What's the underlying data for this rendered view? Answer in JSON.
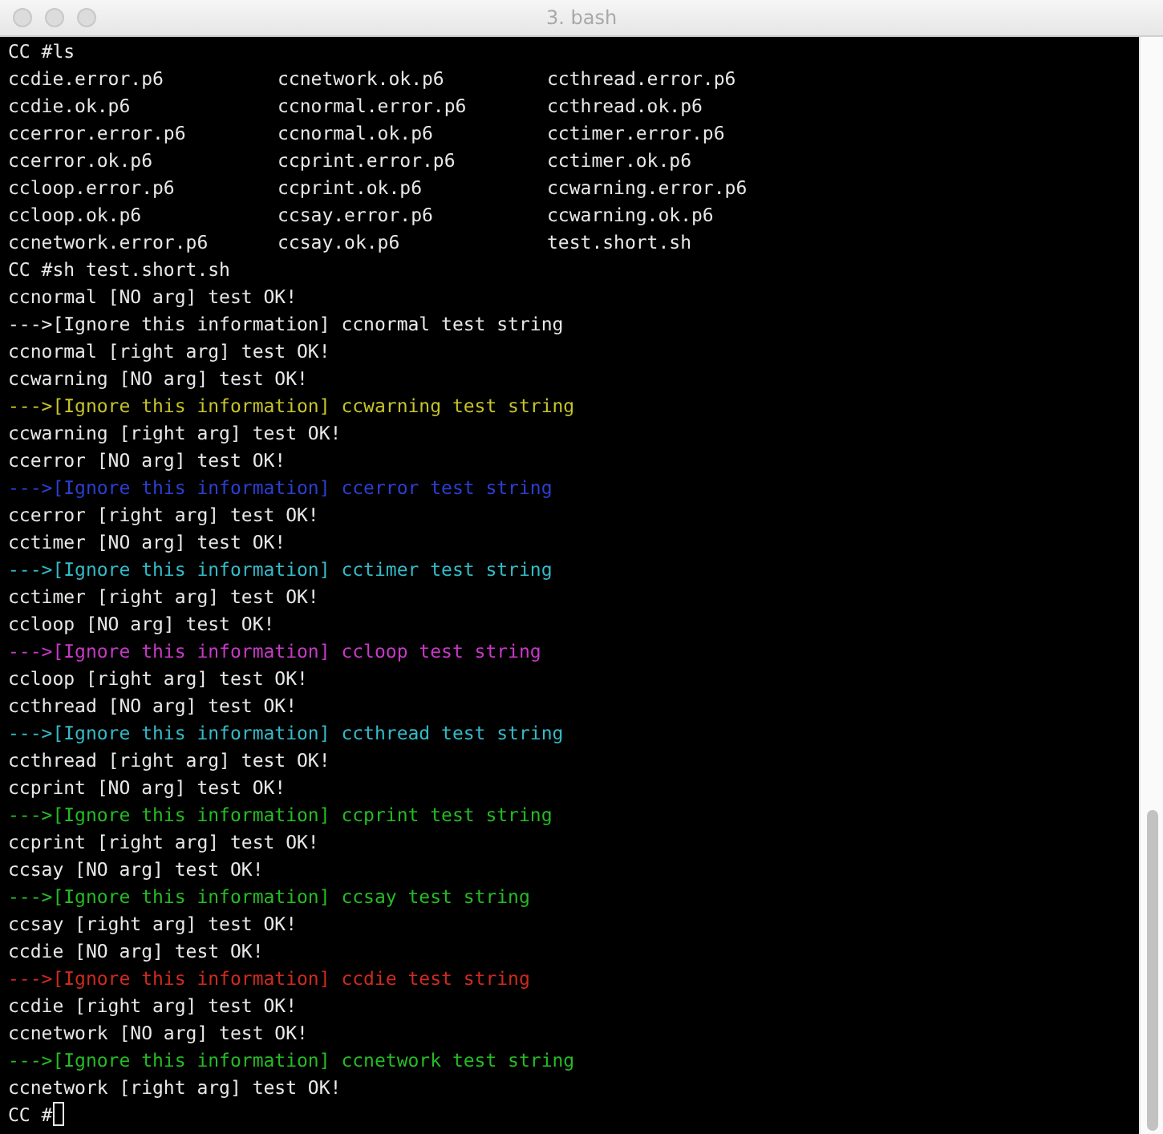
{
  "window": {
    "title": "3. bash"
  },
  "terminal": {
    "lines": [
      {
        "kind": "output",
        "text": "CC #ls"
      },
      {
        "kind": "listing",
        "columns": [
          "ccdie.error.p6",
          "ccnetwork.ok.p6",
          "ccthread.error.p6"
        ]
      },
      {
        "kind": "listing",
        "columns": [
          "ccdie.ok.p6",
          "ccnormal.error.p6",
          "ccthread.ok.p6"
        ]
      },
      {
        "kind": "listing",
        "columns": [
          "ccerror.error.p6",
          "ccnormal.ok.p6",
          "cctimer.error.p6"
        ]
      },
      {
        "kind": "listing",
        "columns": [
          "ccerror.ok.p6",
          "ccprint.error.p6",
          "cctimer.ok.p6"
        ]
      },
      {
        "kind": "listing",
        "columns": [
          "ccloop.error.p6",
          "ccprint.ok.p6",
          "ccwarning.error.p6"
        ]
      },
      {
        "kind": "listing",
        "columns": [
          "ccloop.ok.p6",
          "ccsay.error.p6",
          "ccwarning.ok.p6"
        ]
      },
      {
        "kind": "listing",
        "columns": [
          "ccnetwork.error.p6",
          "ccsay.ok.p6",
          "test.short.sh"
        ]
      },
      {
        "kind": "output",
        "text": "CC #sh test.short.sh"
      },
      {
        "kind": "output",
        "text": "ccnormal [NO arg] test OK!"
      },
      {
        "kind": "output",
        "text": "--->[Ignore this information] ccnormal test string"
      },
      {
        "kind": "output",
        "text": "ccnormal [right arg] test OK!"
      },
      {
        "kind": "output",
        "text": "ccwarning [NO arg] test OK!"
      },
      {
        "kind": "output",
        "text": "--->[Ignore this information] ccwarning test string",
        "color": "#c7c329"
      },
      {
        "kind": "output",
        "text": "ccwarning [right arg] test OK!"
      },
      {
        "kind": "output",
        "text": "ccerror [NO arg] test OK!"
      },
      {
        "kind": "output",
        "text": "--->[Ignore this information] ccerror test string",
        "color": "#2c3fd2"
      },
      {
        "kind": "output",
        "text": "ccerror [right arg] test OK!"
      },
      {
        "kind": "output",
        "text": "cctimer [NO arg] test OK!"
      },
      {
        "kind": "output",
        "text": "--->[Ignore this information] cctimer test string",
        "color": "#33bbc8"
      },
      {
        "kind": "output",
        "text": "cctimer [right arg] test OK!"
      },
      {
        "kind": "output",
        "text": "ccloop [NO arg] test OK!"
      },
      {
        "kind": "output",
        "text": "--->[Ignore this information] ccloop test string",
        "color": "#c839c7"
      },
      {
        "kind": "output",
        "text": "ccloop [right arg] test OK!"
      },
      {
        "kind": "output",
        "text": "ccthread [NO arg] test OK!"
      },
      {
        "kind": "output",
        "text": "--->[Ignore this information] ccthread test string",
        "color": "#33bbc8"
      },
      {
        "kind": "output",
        "text": "ccthread [right arg] test OK!"
      },
      {
        "kind": "output",
        "text": "ccprint [NO arg] test OK!"
      },
      {
        "kind": "output",
        "text": "--->[Ignore this information] ccprint test string",
        "color": "#25bc24"
      },
      {
        "kind": "output",
        "text": "ccprint [right arg] test OK!"
      },
      {
        "kind": "output",
        "text": "ccsay [NO arg] test OK!"
      },
      {
        "kind": "output",
        "text": "--->[Ignore this information] ccsay test string",
        "color": "#25bc24"
      },
      {
        "kind": "output",
        "text": "ccsay [right arg] test OK!"
      },
      {
        "kind": "output",
        "text": "ccdie [NO arg] test OK!"
      },
      {
        "kind": "output",
        "text": "--->[Ignore this information] ccdie test string",
        "color": "#d02a20"
      },
      {
        "kind": "output",
        "text": "ccdie [right arg] test OK!"
      },
      {
        "kind": "output",
        "text": "ccnetwork [NO arg] test OK!"
      },
      {
        "kind": "output",
        "text": "--->[Ignore this information] ccnetwork test string",
        "color": "#25bc24"
      },
      {
        "kind": "output",
        "text": "ccnetwork [right arg] test OK!"
      },
      {
        "kind": "prompt",
        "text": "CC #"
      }
    ]
  }
}
